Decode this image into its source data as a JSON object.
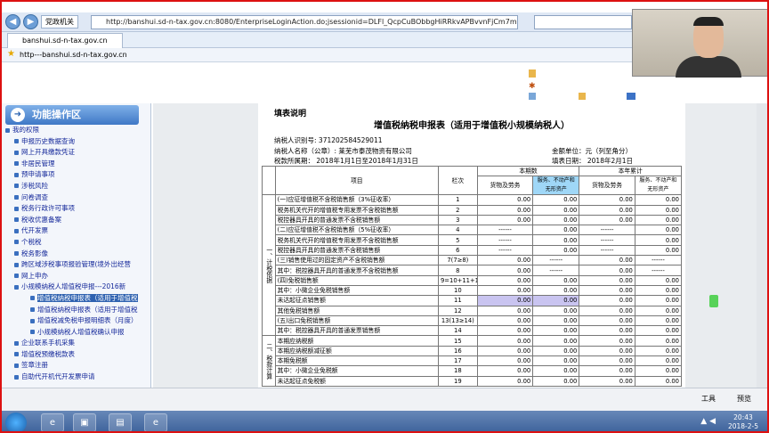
{
  "browser": {
    "back_icon": "back-arrow-icon",
    "forward_icon": "forward-arrow-icon",
    "site_tag": "党政机关",
    "url": "http://banshui.sd-n-tax.gov.cn:8080/EnterpriseLoginAction.do;jsessionid=DLFl_QcpCuBObbgHiRRkvAPBvvnFjCm7mEkYY",
    "tab_title": "banshui.sd-n-tax.gov.cn",
    "favorite": "http---banshui.sd-n-tax.gov.cn",
    "tools_label": "工具",
    "preview_label": "预览"
  },
  "sidebar": {
    "title": "功能操作区",
    "items": [
      {
        "label": "我的权限",
        "level": 0
      },
      {
        "label": "申报历史数据查询",
        "level": 1
      },
      {
        "label": "网上开具缴款凭证",
        "level": 1
      },
      {
        "label": "非居民管理",
        "level": 1
      },
      {
        "label": "预申请事项",
        "level": 1
      },
      {
        "label": "涉税风险",
        "level": 1
      },
      {
        "label": "问卷调查",
        "level": 1
      },
      {
        "label": "税务行政许可事项",
        "level": 1
      },
      {
        "label": "税收优惠备案",
        "level": 1
      },
      {
        "label": "代开发票",
        "level": 1
      },
      {
        "label": "个税税",
        "level": 1
      },
      {
        "label": "税务影像",
        "level": 1
      },
      {
        "label": "跨区域涉税事项报验管理(境外出经营",
        "level": 1
      },
      {
        "label": "网上申办",
        "level": 1
      },
      {
        "label": "小规模纳税人增值税申报---2016新",
        "level": 1
      },
      {
        "label": "增值税纳税申报表（适用于增值税",
        "level": 2,
        "selected": true
      },
      {
        "label": "增值税纳税申报表（适用于增值税",
        "level": 2
      },
      {
        "label": "增值税减免税申报明细表（月度）",
        "level": 2
      },
      {
        "label": "小规模纳税人增值税确认申报",
        "level": 2
      },
      {
        "label": "企业联系手机采集",
        "level": 1
      },
      {
        "label": "增值税预缴税款表",
        "level": 1
      },
      {
        "label": "签章注册",
        "level": 1
      },
      {
        "label": "自助代开机代开发票申请",
        "level": 1
      }
    ]
  },
  "form": {
    "note": "填表说明",
    "title": "增值税纳税申报表（适用于增值税小规模纳税人）",
    "taxpayer_id_label": "纳税人识别号:",
    "taxpayer_id": "371202584529011",
    "taxpayer_name_label": "纳税人名称（公章）:",
    "taxpayer_name": "莱芜市泰茂物资有限公司",
    "amount_unit": "金额单位：元（列至角分）",
    "period_label": "税款所属期：",
    "period": "2018年1月1日至2018年1月31日",
    "fill_date_label": "填表日期：",
    "fill_date": "2018年2月1日",
    "col_item": "项目",
    "col_row": "栏次",
    "col_current": "本期数",
    "col_ytd": "本年累计",
    "col_goods": "货物及劳务",
    "col_services": "服务、不动产和无形资产",
    "side_section1": "一、计税依据",
    "side_section2": "二、税款计算",
    "dash": "------",
    "rows": [
      {
        "label": "(一)应征增值税不含税销售额（3%征收率）",
        "no": "1",
        "v": [
          "0.00",
          "0.00",
          "0.00",
          "0.00"
        ]
      },
      {
        "label": "税务机关代开的增值税专用发票不含税销售额",
        "no": "2",
        "v": [
          "0.00",
          "0.00",
          "0.00",
          "0.00"
        ]
      },
      {
        "label": "税控器具开具的普通发票不含税销售额",
        "no": "3",
        "v": [
          "0.00",
          "0.00",
          "0.00",
          "0.00"
        ]
      },
      {
        "label": "(二)应征增值税不含税销售额（5%征收率）",
        "no": "4",
        "v": [
          "------",
          "0.00",
          "------",
          "0.00"
        ]
      },
      {
        "label": "税务机关代开的增值税专用发票不含税销售额",
        "no": "5",
        "v": [
          "------",
          "0.00",
          "------",
          "0.00"
        ]
      },
      {
        "label": "税控器具开具的普通发票不含税销售额",
        "no": "6",
        "v": [
          "------",
          "0.00",
          "------",
          "0.00"
        ]
      },
      {
        "label": "(三)销售使用过的固定资产不含税销售额",
        "no": "7(7≥8)",
        "v": [
          "0.00",
          "------",
          "0.00",
          "------"
        ]
      },
      {
        "label": "其中：税控器具开具的普通发票不含税销售额",
        "no": "8",
        "v": [
          "0.00",
          "------",
          "0.00",
          "------"
        ]
      },
      {
        "label": "(四)免税销售额",
        "no": "9=10+11+12",
        "v": [
          "0.00",
          "0.00",
          "0.00",
          "0.00"
        ]
      },
      {
        "label": "其中：小微企业免税销售额",
        "no": "10",
        "v": [
          "0.00",
          "0.00",
          "0.00",
          "0.00"
        ]
      },
      {
        "label": "未达起征点销售额",
        "no": "11",
        "v": [
          "0.00",
          "0.00",
          "0.00",
          "0.00"
        ]
      },
      {
        "label": "其他免税销售额",
        "no": "12",
        "v": [
          "0.00",
          "0.00",
          "0.00",
          "0.00"
        ]
      },
      {
        "label": "(五)出口免税销售额",
        "no": "13(13≥14)",
        "v": [
          "0.00",
          "0.00",
          "0.00",
          "0.00"
        ]
      },
      {
        "label": "其中：税控器具开具的普通发票销售额",
        "no": "14",
        "v": [
          "0.00",
          "0.00",
          "0.00",
          "0.00"
        ]
      },
      {
        "label": "本期应纳税额",
        "no": "15",
        "v": [
          "0.00",
          "0.00",
          "0.00",
          "0.00"
        ]
      },
      {
        "label": "本期应纳税额减征额",
        "no": "16",
        "v": [
          "0.00",
          "0.00",
          "0.00",
          "0.00"
        ]
      },
      {
        "label": "本期免税额",
        "no": "17",
        "v": [
          "0.00",
          "0.00",
          "0.00",
          "0.00"
        ]
      },
      {
        "label": "其中：小微企业免税额",
        "no": "18",
        "v": [
          "0.00",
          "0.00",
          "0.00",
          "0.00"
        ]
      },
      {
        "label": "未达起征点免税额",
        "no": "19",
        "v": [
          "0.00",
          "0.00",
          "0.00",
          "0.00"
        ]
      }
    ]
  },
  "taskbar": {
    "time": "20:43",
    "date": "2018-2-5",
    "colors": {
      "accent": "#2f62b0",
      "highlight": "#c9c4f0",
      "border": "#d11111"
    }
  }
}
